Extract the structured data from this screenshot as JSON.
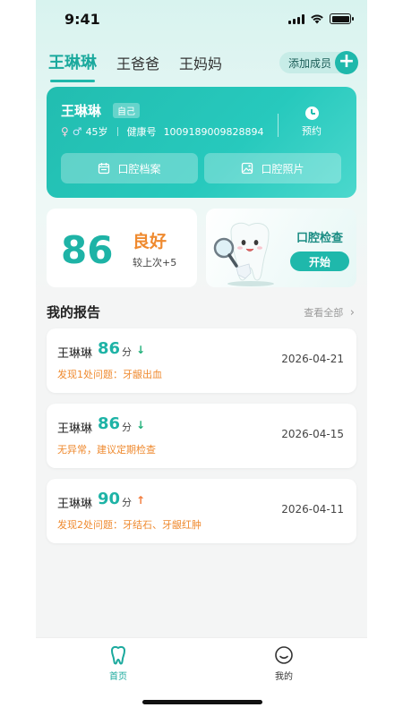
{
  "status_bar": {
    "time": "9:41"
  },
  "member_tabs": [
    {
      "label": "王琳琳",
      "active": true
    },
    {
      "label": "王爸爸",
      "active": false
    },
    {
      "label": "王妈妈",
      "active": false
    }
  ],
  "add_member": {
    "label": "添加成员",
    "icon": "plus-icon"
  },
  "profile": {
    "name": "王琳琳",
    "tag": "自己",
    "age": "45岁",
    "health_no_label": "健康号",
    "health_no": "1009189009828894",
    "appointment_label": "预约",
    "dental_records_label": "口腔档案",
    "dental_photos_label": "口腔照片"
  },
  "score": {
    "value": "86",
    "level": "良好",
    "compare": "较上次+5"
  },
  "check": {
    "title": "口腔检查",
    "start_label": "开始"
  },
  "reports": {
    "title": "我的报告",
    "view_all": "查看全部",
    "items": [
      {
        "name": "王琳琳",
        "score": "86",
        "unit": "分",
        "trend": "down",
        "trend_symbol": "↓",
        "note": "发现1处问题：牙龈出血",
        "date": "2026-04-21"
      },
      {
        "name": "王琳琳",
        "score": "86",
        "unit": "分",
        "trend": "down",
        "trend_symbol": "↓",
        "note": "无异常，建议定期检查",
        "date": "2026-04-15"
      },
      {
        "name": "王琳琳",
        "score": "90",
        "unit": "分",
        "trend": "up",
        "trend_symbol": "↑",
        "note": "发现2处问题：牙结石、牙龈红肿",
        "date": "2026-04-11"
      }
    ]
  },
  "bottom_nav": {
    "home_label": "首页",
    "mine_label": "我的"
  },
  "colors": {
    "accent": "#1fb8ab",
    "warning": "#ef8a2f",
    "up": "#f27a3a",
    "down": "#22b07a"
  }
}
